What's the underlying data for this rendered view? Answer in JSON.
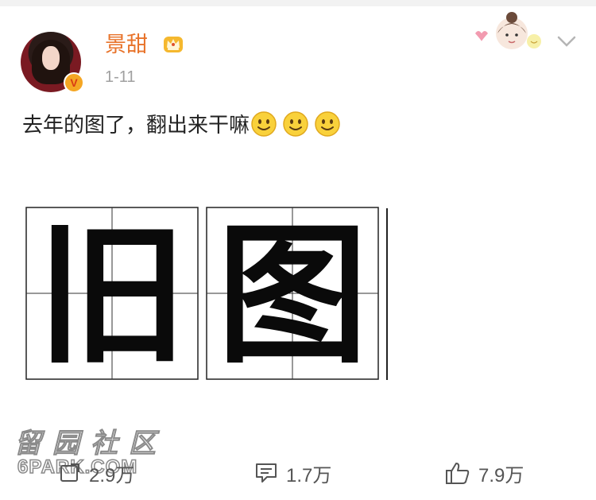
{
  "post": {
    "author": "景甜",
    "time": "1-11",
    "text": "去年的图了，翻出来干嘛",
    "emojis": [
      "smile-emoji",
      "smile-emoji",
      "smile-emoji"
    ],
    "image_chars": [
      "旧",
      "图"
    ]
  },
  "actions": {
    "repost_count": "2.9万",
    "comment_count": "1.7万",
    "like_count": "7.9万"
  },
  "watermark": {
    "cn": "留园社区",
    "en": "6PARK.COM"
  },
  "colors": {
    "username": "#e8732a",
    "verified_badge": "#f5a623",
    "time": "#a0a0a0"
  }
}
